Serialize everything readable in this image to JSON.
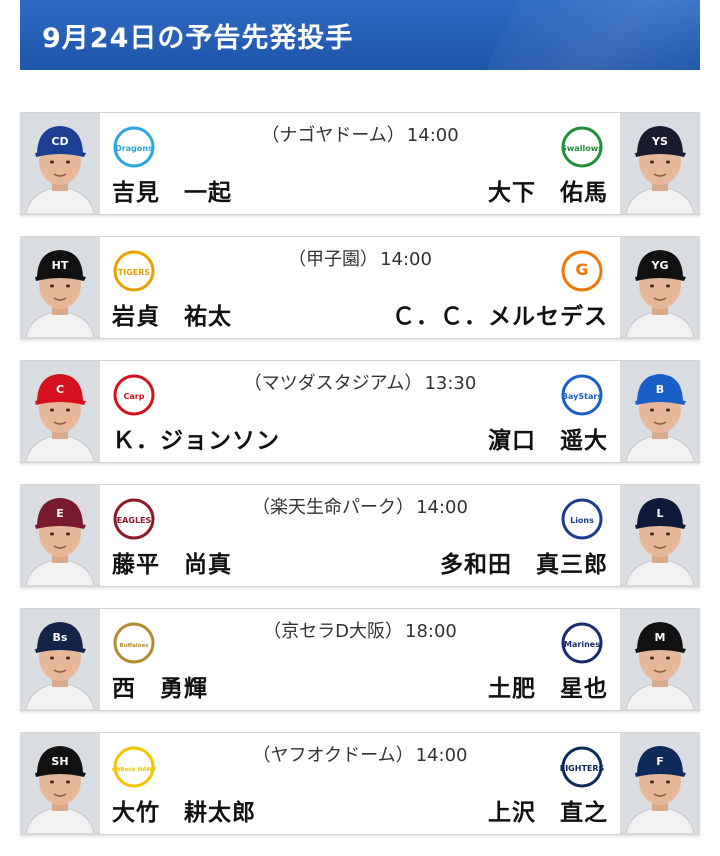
{
  "header": {
    "title": "9月24日の予告先発投手"
  },
  "games": [
    {
      "venue": "（ナゴヤドーム）",
      "time": "14:00",
      "home": {
        "pitcher": "吉見　一起",
        "cap_letter": "CD",
        "cap_color": "#1c3f94",
        "logo_text": "Dragons",
        "logo_color": "#2aa6e0"
      },
      "away": {
        "pitcher": "大下　佑馬",
        "cap_letter": "YS",
        "cap_color": "#1a1a2e",
        "logo_text": "Swallows",
        "logo_color": "#1f8f3a"
      }
    },
    {
      "venue": "（甲子園）",
      "time": "14:00",
      "home": {
        "pitcher": "岩貞　祐太",
        "cap_letter": "HT",
        "cap_color": "#111111",
        "logo_text": "TIGERS",
        "logo_color": "#e8a200"
      },
      "away": {
        "pitcher": "Ｃ．Ｃ．メルセデス",
        "cap_letter": "YG",
        "cap_color": "#111111",
        "logo_text": "G",
        "logo_color": "#f07800"
      }
    },
    {
      "venue": "（マツダスタジアム）",
      "time": "13:30",
      "home": {
        "pitcher": "Ｋ．ジョンソン",
        "cap_letter": "C",
        "cap_color": "#d5111e",
        "logo_text": "Carp",
        "logo_color": "#d5111e"
      },
      "away": {
        "pitcher": "濵口　遥大",
        "cap_letter": "B",
        "cap_color": "#1a5fc8",
        "logo_text": "BayStars",
        "logo_color": "#1a5fc8"
      }
    },
    {
      "venue": "（楽天生命パーク）",
      "time": "14:00",
      "home": {
        "pitcher": "藤平　尚真",
        "cap_letter": "E",
        "cap_color": "#7a1a2e",
        "logo_text": "EAGLES",
        "logo_color": "#8b1a2b"
      },
      "away": {
        "pitcher": "多和田　真三郎",
        "cap_letter": "L",
        "cap_color": "#0f1a3a",
        "logo_text": "Lions",
        "logo_color": "#1c3c8c"
      }
    },
    {
      "venue": "（京セラD大阪）",
      "time": "18:00",
      "home": {
        "pitcher": "西　勇輝",
        "cap_letter": "Bs",
        "cap_color": "#14234a",
        "logo_text": "Buffaloes",
        "logo_color": "#b48a2e"
      },
      "away": {
        "pitcher": "土肥　星也",
        "cap_letter": "M",
        "cap_color": "#111111",
        "logo_text": "Marines",
        "logo_color": "#1a2a6c"
      }
    },
    {
      "venue": "（ヤフオクドーム）",
      "time": "14:00",
      "home": {
        "pitcher": "大竹　耕太郎",
        "cap_letter": "SH",
        "cap_color": "#111111",
        "logo_text": "SoftBank HAWKS",
        "logo_color": "#f2c500"
      },
      "away": {
        "pitcher": "上沢　直之",
        "cap_letter": "F",
        "cap_color": "#0d2a5a",
        "logo_text": "FIGHTERS",
        "logo_color": "#0d2a5a"
      }
    }
  ]
}
